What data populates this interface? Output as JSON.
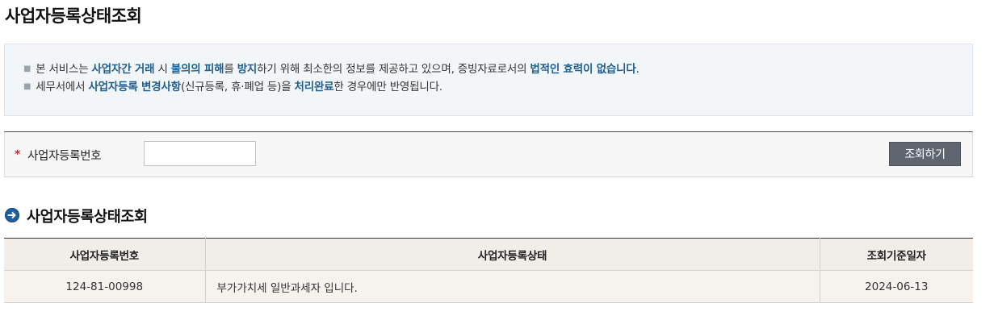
{
  "page": {
    "title": "사업자등록상태조회"
  },
  "notice": {
    "line1": [
      {
        "text": "본 서비스는 ",
        "hl": false
      },
      {
        "text": "사업자간 거래",
        "hl": true
      },
      {
        "text": " 시 ",
        "hl": false
      },
      {
        "text": "불의의 피해",
        "hl": true
      },
      {
        "text": "를 ",
        "hl": false
      },
      {
        "text": "방지",
        "hl": true
      },
      {
        "text": "하기 위해 최소한의 정보를 제공하고 있으며, 증빙자료로서의 ",
        "hl": false
      },
      {
        "text": "법적인 효력이 없습니다",
        "hl": true
      },
      {
        "text": ".",
        "hl": false
      }
    ],
    "line2": [
      {
        "text": "세무서에서 ",
        "hl": false
      },
      {
        "text": "사업자등록 변경사항",
        "hl": true
      },
      {
        "text": "(신규등록, 휴·폐업 등)을 ",
        "hl": false
      },
      {
        "text": "처리완료",
        "hl": true
      },
      {
        "text": "한 경우에만 반영됩니다.",
        "hl": false
      }
    ],
    "highlight_color": "#1f5f8f"
  },
  "search": {
    "required_mark": "*",
    "label": "사업자등록번호",
    "value": "",
    "placeholder": "",
    "button_label": "조회하기"
  },
  "results": {
    "section_title": "사업자등록상태조회",
    "columns": [
      "사업자등록번호",
      "사업자등록상태",
      "조회기준일자"
    ],
    "rows": [
      [
        "124-81-00998",
        "부가가치세 일반과세자 입니다.",
        "2024-06-13"
      ]
    ]
  }
}
